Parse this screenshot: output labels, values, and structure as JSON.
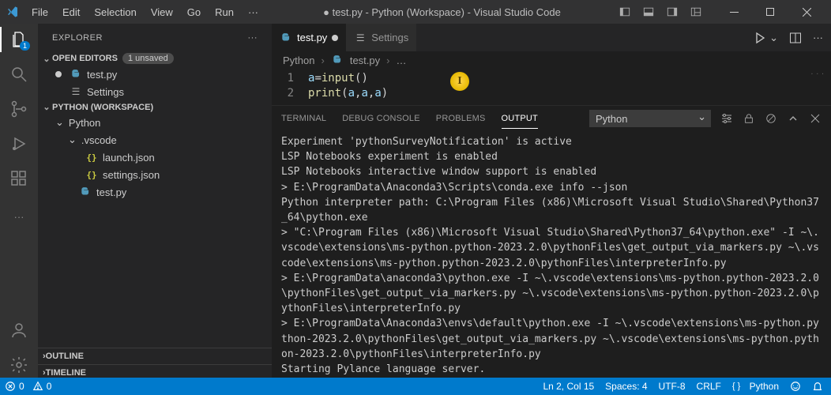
{
  "titlebar": {
    "window_title": "● test.py - Python (Workspace) - Visual Studio Code",
    "menu": {
      "file": "File",
      "edit": "Edit",
      "selection": "Selection",
      "view": "View",
      "go": "Go",
      "run": "Run",
      "more": "···"
    }
  },
  "activitybar": {
    "explorer_badge": "1"
  },
  "sidebar": {
    "title": "EXPLORER",
    "open_editors": {
      "label": "OPEN EDITORS",
      "unsaved_badge": "1 unsaved"
    },
    "open_editors_items": {
      "testpy": "test.py",
      "settings": "Settings"
    },
    "workspace_label": "PYTHON (WORKSPACE)",
    "folders": {
      "python": "Python",
      "vscode": ".vscode",
      "launch": "launch.json",
      "settings": "settings.json",
      "testpy": "test.py"
    },
    "outline": "OUTLINE",
    "timeline": "TIMELINE"
  },
  "tabs": {
    "testpy": "test.py",
    "settings": "Settings"
  },
  "breadcrumbs": {
    "root": "Python",
    "file": "test.py",
    "more": "…"
  },
  "code": {
    "line1": {
      "num": "1",
      "a": "a",
      "eq": " = ",
      "fn": "input",
      "paren": "()"
    },
    "line2": {
      "num": "2",
      "fn": "print",
      "open": "(",
      "arg1": "a",
      "c1": ", ",
      "arg2": "a",
      "c2": ", ",
      "arg3": "a",
      "close": ")"
    }
  },
  "panel": {
    "tabs": {
      "terminal": "TERMINAL",
      "debug": "DEBUG CONSOLE",
      "problems": "PROBLEMS",
      "output": "OUTPUT"
    },
    "filter_label": "Python",
    "output_text": "Experiment 'pythonSurveyNotification' is active\nLSP Notebooks experiment is enabled\nLSP Notebooks interactive window support is enabled\n> E:\\ProgramData\\Anaconda3\\Scripts\\conda.exe info --json\nPython interpreter path: C:\\Program Files (x86)\\Microsoft Visual Studio\\Shared\\Python37_64\\python.exe\n> \"C:\\Program Files (x86)\\Microsoft Visual Studio\\Shared\\Python37_64\\python.exe\" -I ~\\.vscode\\extensions\\ms-python.python-2023.2.0\\pythonFiles\\get_output_via_markers.py ~\\.vscode\\extensions\\ms-python.python-2023.2.0\\pythonFiles\\interpreterInfo.py\n> E:\\ProgramData\\anaconda3\\python.exe -I ~\\.vscode\\extensions\\ms-python.python-2023.2.0\\pythonFiles\\get_output_via_markers.py ~\\.vscode\\extensions\\ms-python.python-2023.2.0\\pythonFiles\\interpreterInfo.py\n> E:\\ProgramData\\Anaconda3\\envs\\default\\python.exe -I ~\\.vscode\\extensions\\ms-python.python-2023.2.0\\pythonFiles\\get_output_via_markers.py ~\\.vscode\\extensions\\ms-python.python-2023.2.0\\pythonFiles\\interpreterInfo.py\nStarting Pylance language server."
  },
  "statusbar": {
    "errors": "0",
    "warnings": "0",
    "cursor": "Ln 2, Col 15",
    "spaces": "Spaces: 4",
    "encoding": "UTF-8",
    "eol": "CRLF",
    "lang": "Python"
  }
}
